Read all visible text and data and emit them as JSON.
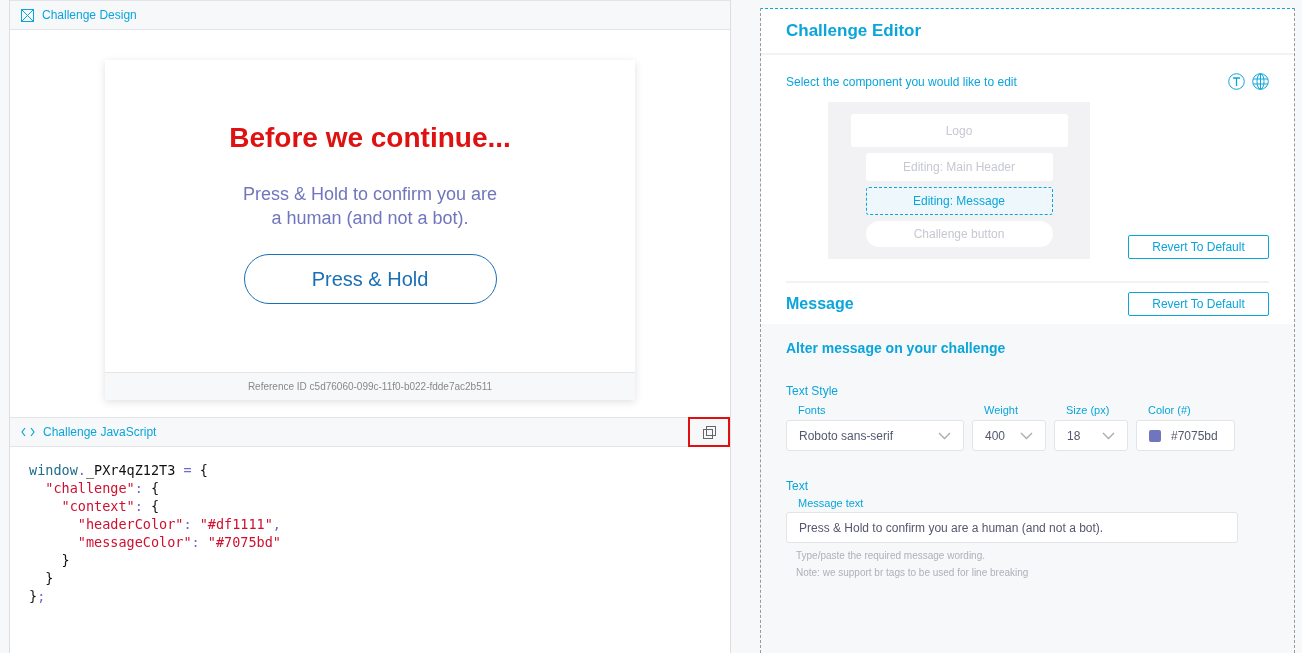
{
  "design_panel": {
    "title": "Challenge Design"
  },
  "preview": {
    "heading": "Before we continue...",
    "message_lines": [
      "Press & Hold to confirm you are",
      "a human (and not a bot)."
    ],
    "button": "Press & Hold",
    "reference": "Reference ID c5d76060-099c-11f0-b022-fdde7ac2b511"
  },
  "js_panel": {
    "title": "Challenge JavaScript",
    "code": [
      [
        {
          "kind": "ident",
          "text": "window"
        },
        {
          "kind": "punct",
          "text": "."
        },
        {
          "kind": "plain",
          "text": "_PXr4qZ12T3 "
        },
        {
          "kind": "punct",
          "text": "= "
        },
        {
          "kind": "plain",
          "text": "{"
        }
      ],
      [
        {
          "kind": "string",
          "text": "  \"challenge\""
        },
        {
          "kind": "punct",
          "text": ": "
        },
        {
          "kind": "plain",
          "text": "{"
        }
      ],
      [
        {
          "kind": "string",
          "text": "    \"context\""
        },
        {
          "kind": "punct",
          "text": ": "
        },
        {
          "kind": "plain",
          "text": "{"
        }
      ],
      [
        {
          "kind": "string",
          "text": "      \"headerColor\""
        },
        {
          "kind": "punct",
          "text": ": "
        },
        {
          "kind": "string",
          "text": "\"#df1111\""
        },
        {
          "kind": "punct",
          "text": ","
        }
      ],
      [
        {
          "kind": "string",
          "text": "      \"messageColor\""
        },
        {
          "kind": "punct",
          "text": ": "
        },
        {
          "kind": "string",
          "text": "\"#7075bd\""
        }
      ],
      [
        {
          "kind": "plain",
          "text": "    }"
        }
      ],
      [
        {
          "kind": "plain",
          "text": "  }"
        }
      ],
      [
        {
          "kind": "plain",
          "text": "}"
        },
        {
          "kind": "punct",
          "text": ";"
        }
      ]
    ]
  },
  "editor": {
    "title": "Challenge Editor",
    "prompt": "Select the component you would like to edit",
    "components": [
      {
        "kind": "logo",
        "label": "Logo",
        "selected": false
      },
      {
        "kind": "text",
        "label": "Editing: Main Header",
        "selected": false
      },
      {
        "kind": "text",
        "label": "Editing: Message",
        "selected": true
      },
      {
        "kind": "button",
        "label": "Challenge button",
        "selected": false
      }
    ],
    "revert_button": "Revert To Default"
  },
  "message_section": {
    "title": "Message",
    "revert_button": "Revert To Default",
    "subtitle": "Alter message on your challenge",
    "text_style_label": "Text Style",
    "fields": [
      {
        "kind": "select",
        "label": "Fonts",
        "value": "Roboto sans-serif"
      },
      {
        "kind": "select",
        "label": "Weight",
        "value": "400"
      },
      {
        "kind": "select",
        "label": "Size (px)",
        "value": "18"
      },
      {
        "kind": "color",
        "label": "Color (#)",
        "value": "#7075bd",
        "color": "#7075bd"
      }
    ],
    "text_label": "Text",
    "message_label": "Message text",
    "message_value": "Press & Hold to confirm you are a human (and not a bot).",
    "hints": [
      "Type/paste the required message wording.",
      "Note: we support br tags to be used for line breaking"
    ]
  }
}
